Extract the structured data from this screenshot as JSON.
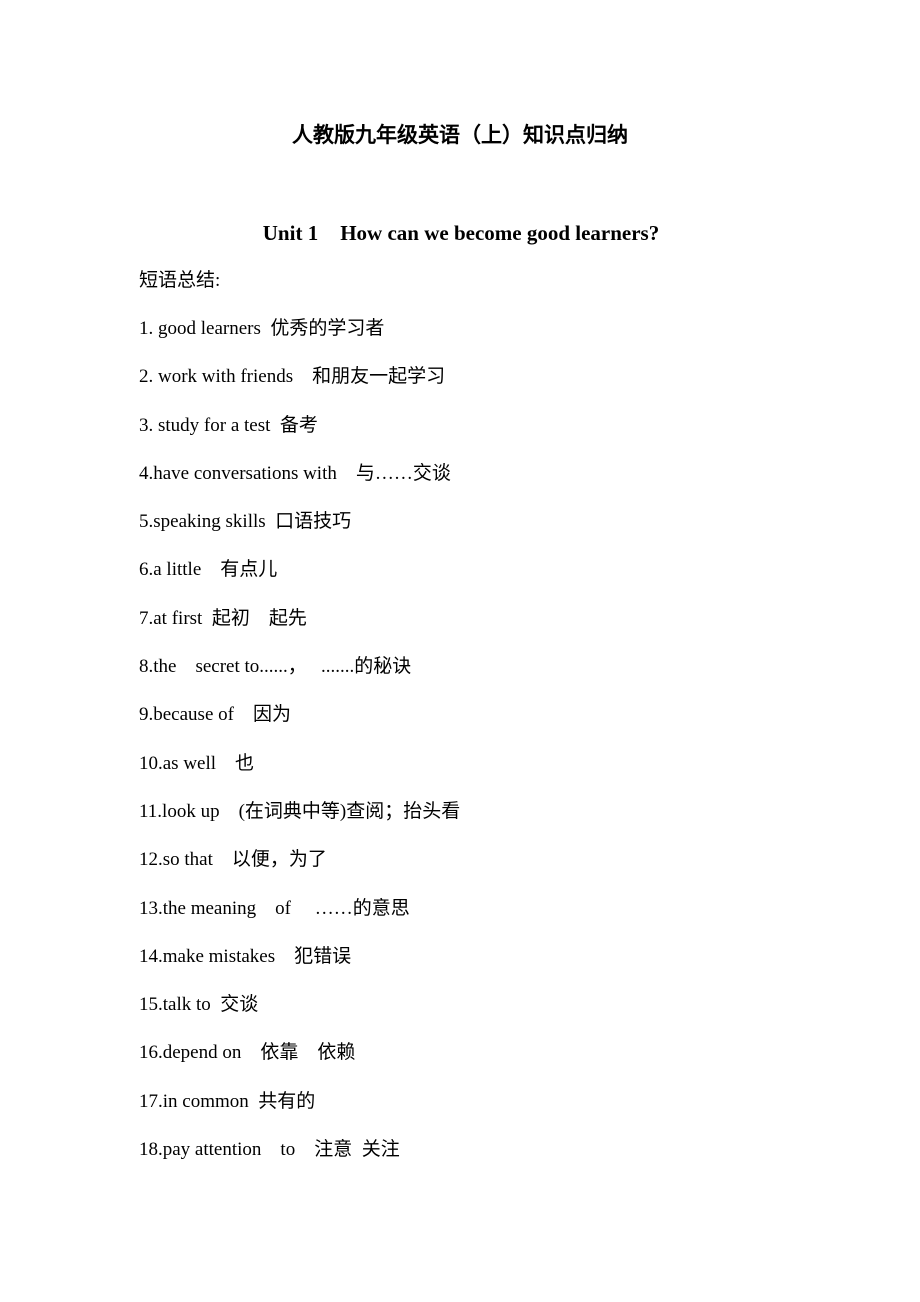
{
  "document": {
    "title": "人教版九年级英语（上）知识点归纳",
    "unit": {
      "number": "Unit 1",
      "heading": "How can we become good learners?"
    },
    "section_label": "短语总结:",
    "phrases": [
      "1. good learners  优秀的学习者",
      "2. work with friends    和朋友一起学习",
      "3. study for a test  备考",
      "4.have conversations with    与……交谈",
      "5.speaking skills  口语技巧",
      "6.a little    有点儿",
      "7.at first  起初    起先",
      "8.the    secret to......，   .......的秘诀",
      "9.because of    因为",
      "10.as well    也",
      "11.look up    (在词典中等)查阅；抬头看",
      "12.so that    以便，为了",
      "13.the meaning    of     ……的意思",
      "14.make mistakes    犯错误",
      "15.talk to  交谈",
      "16.depend on    依靠    依赖",
      "17.in common  共有的",
      "18.pay attention    to    注意  关注"
    ]
  }
}
